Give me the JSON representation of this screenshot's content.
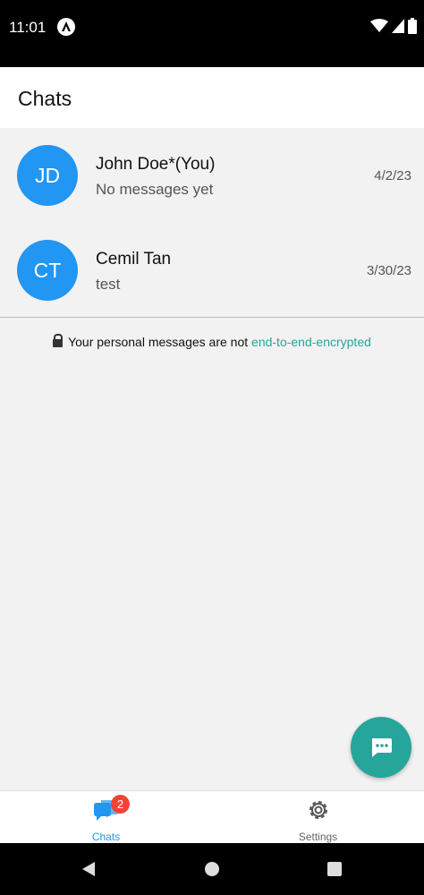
{
  "status_bar": {
    "time": "11:01"
  },
  "header": {
    "title": "Chats"
  },
  "chats": [
    {
      "initials": "JD",
      "name": "John Doe*(You)",
      "preview": "No messages yet",
      "date": "4/2/23"
    },
    {
      "initials": "CT",
      "name": "Cemil Tan",
      "preview": "test",
      "date": "3/30/23"
    }
  ],
  "encryption_note": {
    "text": "Your personal messages are not ",
    "link": "end-to-end-encrypted"
  },
  "fab": {
    "icon": "new-message-icon"
  },
  "bottom_nav": {
    "tabs": [
      {
        "label": "Chats",
        "icon": "chats-icon",
        "badge": "2",
        "active": true
      },
      {
        "label": "Settings",
        "icon": "gear-icon",
        "active": false
      }
    ]
  },
  "colors": {
    "accent": "#2196f3",
    "teal": "#26a69a",
    "badge": "#f44336"
  }
}
